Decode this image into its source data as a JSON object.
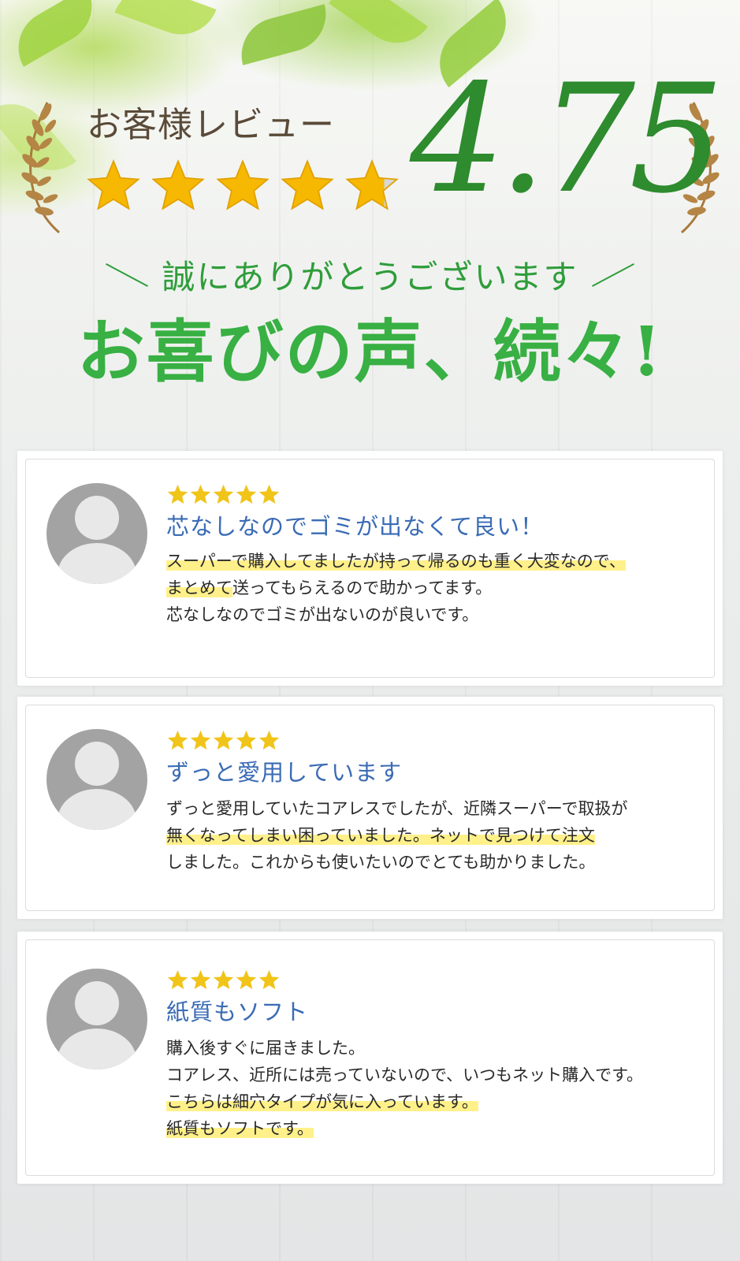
{
  "header": {
    "review_label": "お客様レビュー",
    "score": "4.75",
    "stars_full": 4,
    "stars_partial_fraction": 0.75,
    "thanks": "誠にありがとうございます",
    "headline": "お喜びの声、続々!"
  },
  "colors": {
    "score_green": "#2e8b2e",
    "headline_green": "#38b043",
    "title_blue": "#3a6bb5",
    "star_gold": "#f0c419",
    "highlight_yellow": "#fff08a"
  },
  "reviews": [
    {
      "stars": 5,
      "title": "芯なしなのでゴミが出なくて良い！",
      "lines": [
        {
          "text": "スーパーで購入してましたが持って帰るのも重く大変なので、",
          "highlight": true
        },
        {
          "text": "まとめて送ってもらえるので助かってます。",
          "highlight": false,
          "hl_prefix": "まとめて"
        },
        {
          "text": "芯なしなのでゴミが出ないのが良いです。",
          "highlight": false
        }
      ]
    },
    {
      "stars": 5,
      "title": "ずっと愛用しています",
      "lines": [
        {
          "text": "ずっと愛用していたコアレスでしたが、近隣スーパーで取扱が",
          "highlight": false
        },
        {
          "text": "無くなってしまい困っていました。ネットで見つけて注文",
          "highlight": true
        },
        {
          "text": "しました。これからも使いたいのでとても助かりました。",
          "highlight": false
        }
      ]
    },
    {
      "stars": 5,
      "title": "紙質もソフト",
      "lines": [
        {
          "text": "購入後すぐに届きました。",
          "highlight": false
        },
        {
          "text": "コアレス、近所には売っていないので、いつもネット購入です。",
          "highlight": false
        },
        {
          "text": "こちらは細穴タイプが気に入っています。",
          "highlight": true
        },
        {
          "text": "紙質もソフトです。",
          "highlight": true
        }
      ]
    }
  ]
}
